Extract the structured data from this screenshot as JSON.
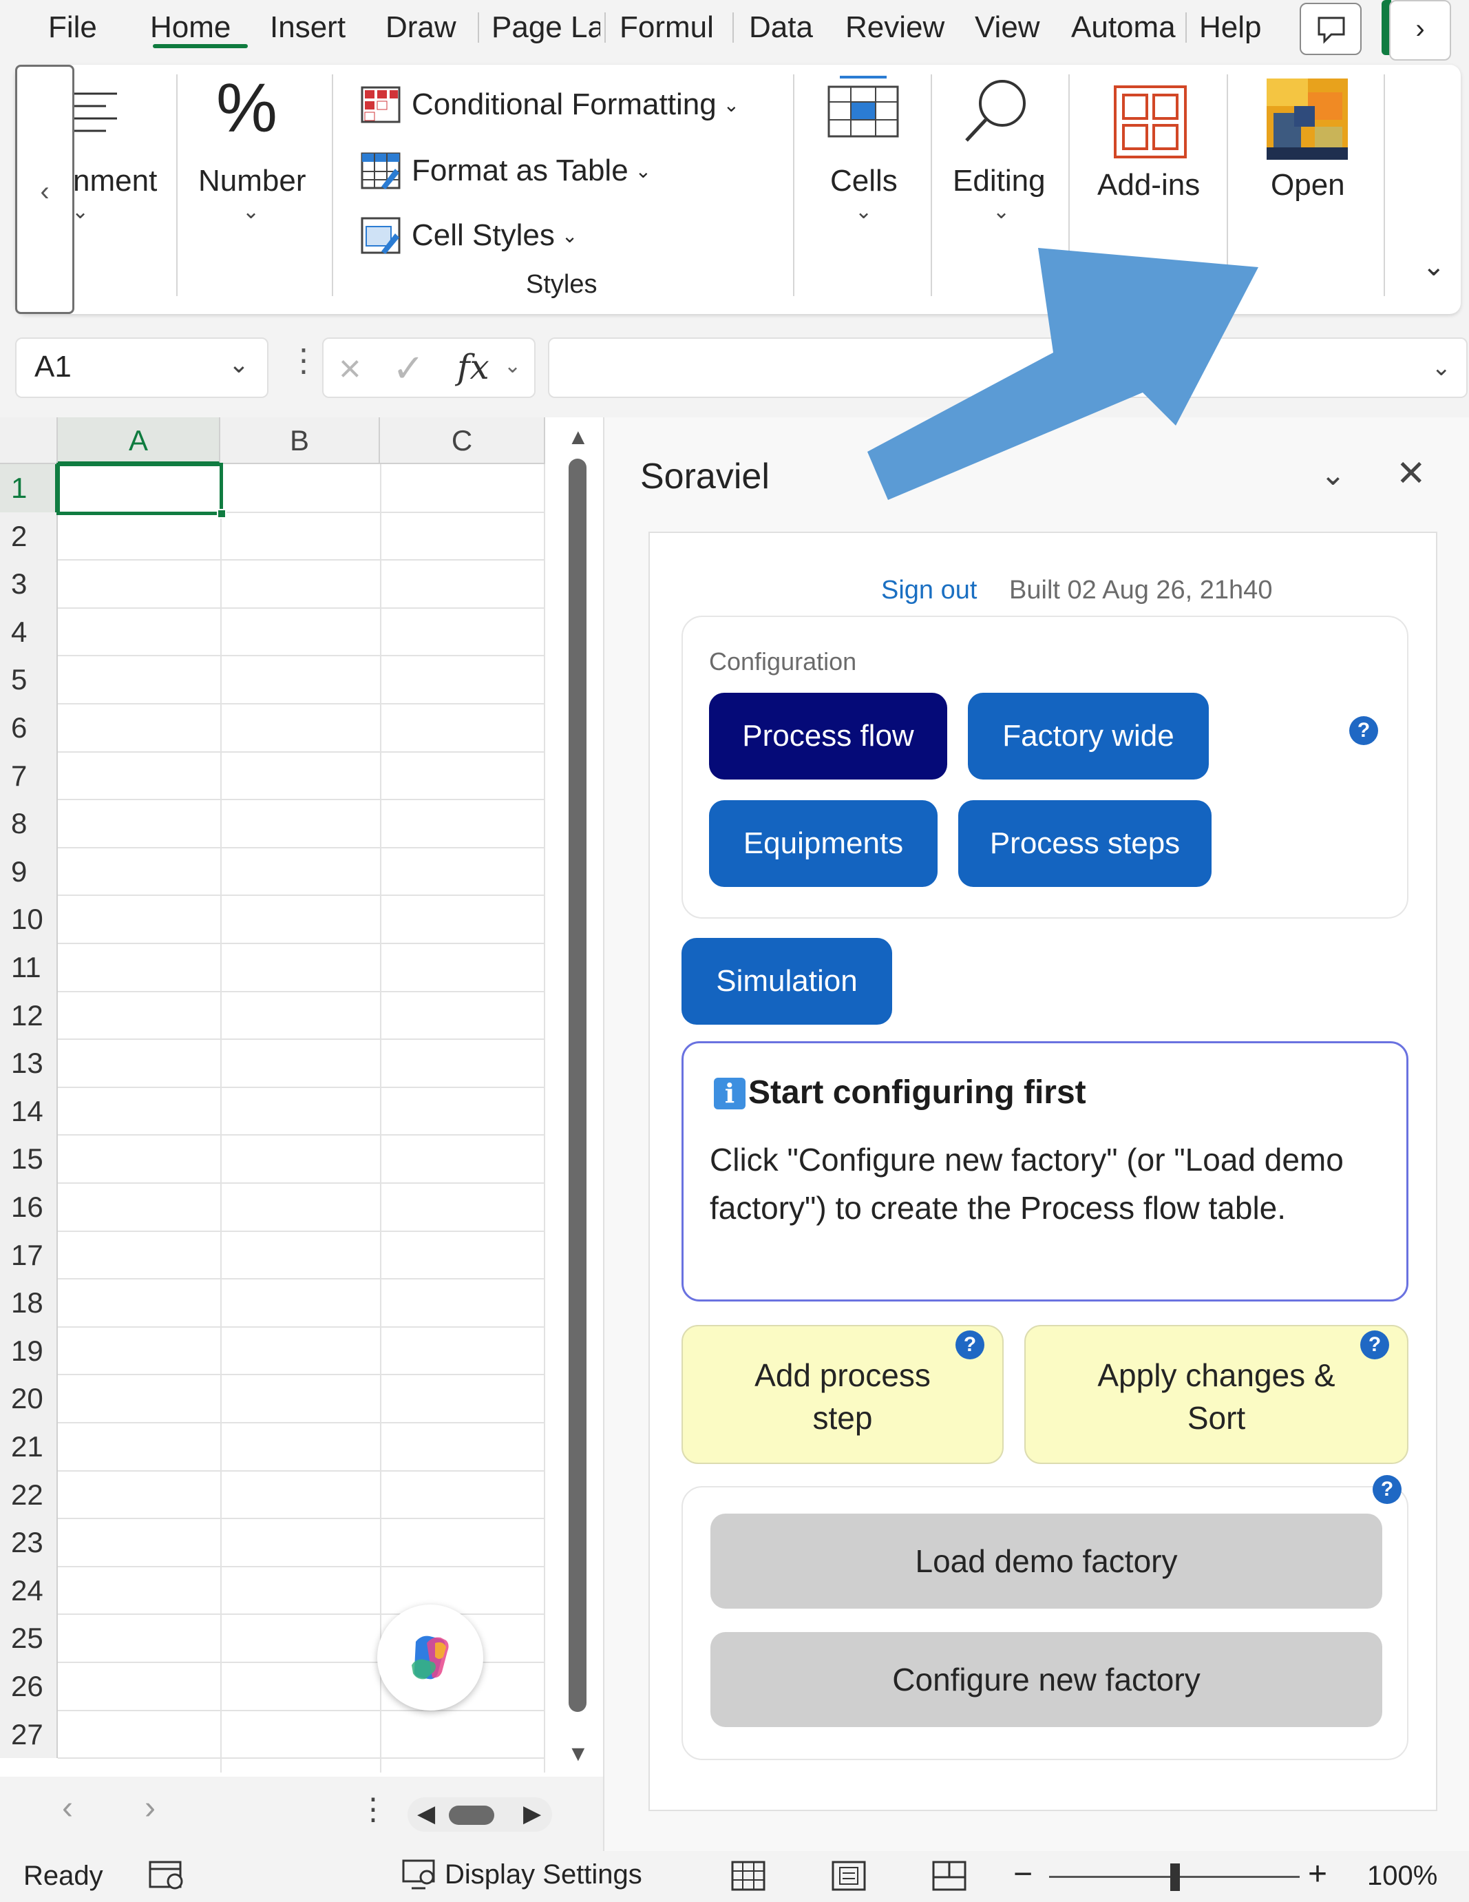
{
  "tabs": [
    "File",
    "Home",
    "Insert",
    "Draw",
    "Page La",
    "Formul",
    "Data",
    "Review",
    "View",
    "Automa",
    "Help"
  ],
  "active_tab": "Home",
  "ribbon": {
    "alignment_label": "nment",
    "number_label": "Number",
    "conditional_formatting": "Conditional Formatting",
    "format_as_table": "Format as Table",
    "cell_styles": "Cell Styles",
    "styles_group": "Styles",
    "cells_label": "Cells",
    "editing_label": "Editing",
    "addins_label": "Add-ins",
    "open_label": "Open"
  },
  "formula_bar": {
    "name_box": "A1",
    "fx": "fx",
    "formula": ""
  },
  "grid": {
    "columns": [
      "A",
      "B",
      "C"
    ],
    "rows": [
      "1",
      "2",
      "3",
      "4",
      "5",
      "6",
      "7",
      "8",
      "9",
      "10",
      "11",
      "12",
      "13",
      "14",
      "15",
      "16",
      "17",
      "18",
      "19",
      "20",
      "21",
      "22",
      "23",
      "24",
      "25",
      "26",
      "27"
    ],
    "active_cell": "A1"
  },
  "status": {
    "ready": "Ready",
    "display_settings": "Display Settings",
    "zoom": "100%",
    "zoom_minus": "−",
    "zoom_plus": "+"
  },
  "pane": {
    "title": "Soraviel",
    "sign_out": "Sign out",
    "built": "Built 02 Aug 26, 21h40",
    "configuration_label": "Configuration",
    "buttons": {
      "process_flow": "Process flow",
      "factory_wide": "Factory wide",
      "equipments": "Equipments",
      "process_steps": "Process steps",
      "simulation": "Simulation"
    },
    "help_glyph": "?",
    "info": {
      "icon": "i",
      "title": "Start configuring first",
      "text": "Click \"Configure new factory\" (or \"Load demo factory\") to create the Process flow table."
    },
    "add_process_step": "Add process step",
    "apply_changes": "Apply changes & Sort",
    "load_demo": "Load demo factory",
    "configure_new": "Configure new factory"
  },
  "colors": {
    "excel_green": "#107c41",
    "pane_blue": "#1464c0",
    "pane_dark_blue": "#050a78",
    "arrow_blue": "#5b9bd5",
    "yellow_bg": "#fbfbc4",
    "gray_btn": "#cfcfcf"
  }
}
